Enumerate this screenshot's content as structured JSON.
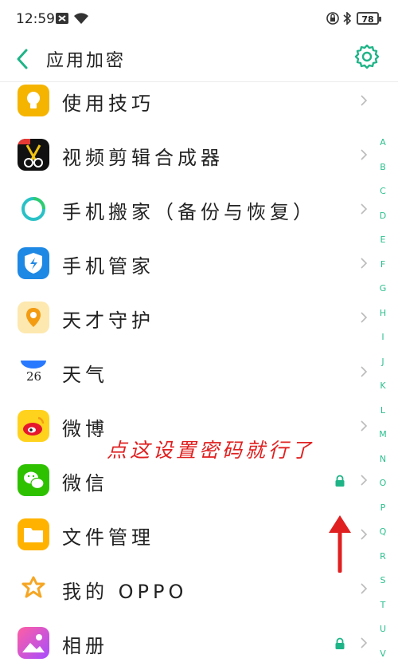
{
  "status_bar": {
    "time": "12:59",
    "battery": "78"
  },
  "header": {
    "title": "应用加密",
    "accent": "#1fb487"
  },
  "apps": [
    {
      "label": "使用技巧",
      "icon": "lightbulb-icon",
      "locked": false
    },
    {
      "label": "视频剪辑合成器",
      "icon": "video-editor-icon",
      "locked": false
    },
    {
      "label": "手机搬家（备份与恢复）",
      "icon": "phone-clone-icon",
      "locked": false
    },
    {
      "label": "手机管家",
      "icon": "phone-manager-icon",
      "locked": false
    },
    {
      "label": "天才守护",
      "icon": "location-guard-icon",
      "locked": false
    },
    {
      "label": "天气",
      "icon": "weather-icon",
      "weather_day": "26",
      "locked": false
    },
    {
      "label": "微博",
      "icon": "weibo-icon",
      "locked": false
    },
    {
      "label": "微信",
      "icon": "wechat-icon",
      "locked": true
    },
    {
      "label": "文件管理",
      "icon": "file-manager-icon",
      "locked": false
    },
    {
      "label": "我的 OPPO",
      "icon": "my-oppo-icon",
      "locked": false
    },
    {
      "label": "相册",
      "icon": "gallery-icon",
      "locked": true
    }
  ],
  "index_letters": [
    "A",
    "B",
    "C",
    "D",
    "E",
    "F",
    "G",
    "H",
    "I",
    "J",
    "K",
    "L",
    "M",
    "N",
    "O",
    "P",
    "Q",
    "R",
    "S",
    "T",
    "U",
    "V"
  ],
  "annotation": {
    "text": "点这设置密码就行了",
    "color": "#e02020"
  }
}
